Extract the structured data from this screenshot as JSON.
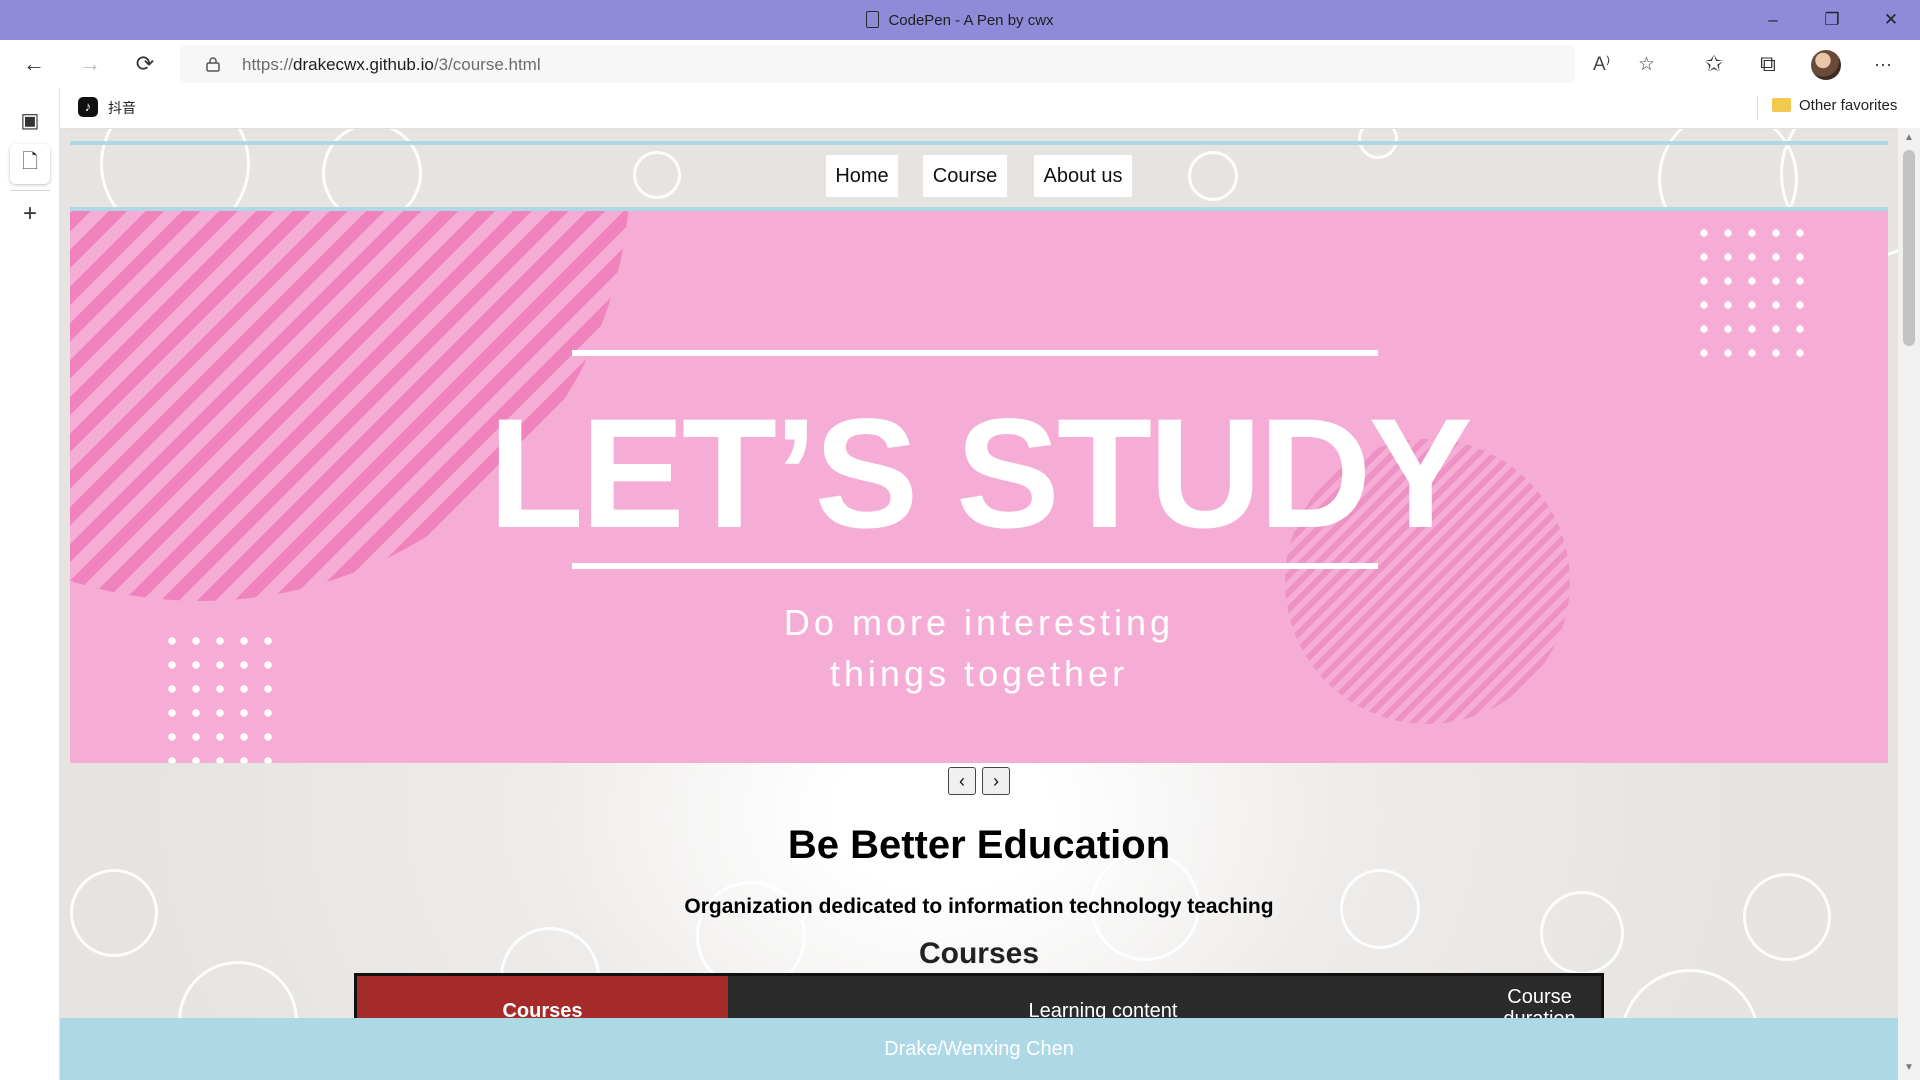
{
  "window": {
    "title": "CodePen - A Pen by cwx",
    "controls": {
      "minimize": "–",
      "restore": "❐",
      "close": "✕"
    }
  },
  "toolbar": {
    "back_icon": "←",
    "forward_icon": "→",
    "refresh_icon": "⟳",
    "url_prefix": "https://",
    "url_host": "drakecwx.github.io",
    "url_path": "/3/course.html",
    "read_aloud_icon": "A⁾",
    "add_favorite_icon": "☆",
    "favorites_icon": "✩",
    "collections_icon": "⧉",
    "more_icon": "···"
  },
  "favorites_bar": {
    "items": [
      {
        "label": "抖音",
        "icon": "♪"
      }
    ],
    "other_favorites": "Other favorites"
  },
  "sidebar": {
    "tab_actions_icon": "▣",
    "page_icon": "🗋",
    "add_icon": "+"
  },
  "page": {
    "nav": [
      "Home",
      "Course",
      "About us"
    ],
    "banner": {
      "headline": "LET’S STUDY",
      "sub_line1": "Do more interesting",
      "sub_line2": "things together",
      "color": "#f6add5"
    },
    "slider": {
      "prev": "‹",
      "next": "›"
    },
    "heading": "Be Better Education",
    "subheading": "Organization dedicated to information technology teaching",
    "section_title": "Courses",
    "table": {
      "headers": [
        "Courses",
        "Learning content",
        "Course duration"
      ],
      "highlight_color": "#a52a2a"
    },
    "footer": "Drake/Wenxing Chen",
    "accent": "#add8e6"
  }
}
